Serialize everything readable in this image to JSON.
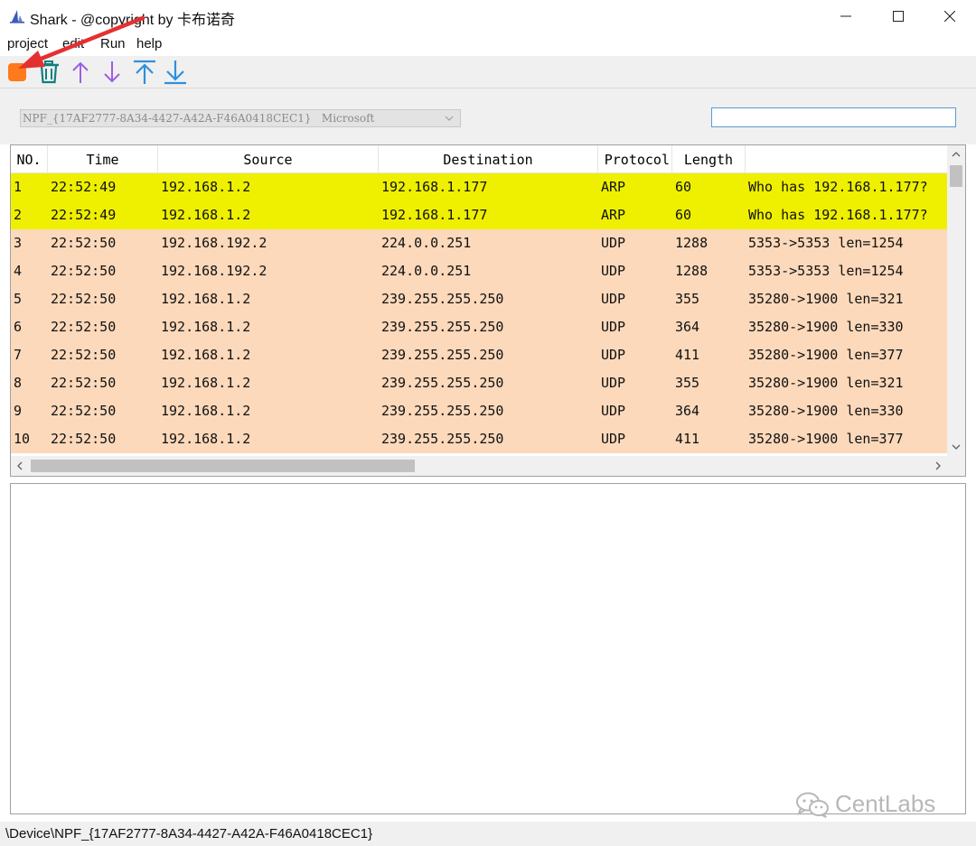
{
  "window": {
    "title": "Shark - @copyright by 卡布诺奇",
    "app_icon": "shark-fin-icon",
    "controls": [
      "minimize-icon",
      "maximize-icon",
      "close-icon"
    ]
  },
  "menu": {
    "items": [
      "project",
      "edit",
      "Run",
      "help"
    ]
  },
  "toolbar": {
    "tools": [
      {
        "name": "stop-capture",
        "icon": "stop-square-icon",
        "color": "#ff7a1a"
      },
      {
        "name": "clear",
        "icon": "trash-icon",
        "color": "#0f7f7f"
      },
      {
        "name": "scroll-up",
        "icon": "arrow-up-icon",
        "color": "#a05ce6"
      },
      {
        "name": "scroll-down",
        "icon": "arrow-down-icon",
        "color": "#a05ce6"
      },
      {
        "name": "scroll-top",
        "icon": "arrow-to-top-icon",
        "color": "#2f8fdc"
      },
      {
        "name": "scroll-bottom",
        "icon": "arrow-to-bottom-icon",
        "color": "#2f8fdc"
      }
    ]
  },
  "interface": {
    "selected": "NPF_{17AF2777-8A34-4427-A42A-F46A0418CEC1}   Microsoft"
  },
  "filter": {
    "value": "",
    "placeholder": ""
  },
  "packets": {
    "columns": [
      "NO.",
      "Time",
      "Source",
      "Destination",
      "Protocol",
      "Length",
      ""
    ],
    "rows": [
      {
        "no": "1",
        "time": "22:52:49",
        "src": "192.168.1.2",
        "dst": "192.168.1.177",
        "proto": "ARP",
        "len": "60",
        "info": "Who has 192.168.1.177?",
        "color": "#eef000"
      },
      {
        "no": "2",
        "time": "22:52:49",
        "src": "192.168.1.2",
        "dst": "192.168.1.177",
        "proto": "ARP",
        "len": "60",
        "info": "Who has 192.168.1.177?",
        "color": "#eef000"
      },
      {
        "no": "3",
        "time": "22:52:50",
        "src": "192.168.192.2",
        "dst": "224.0.0.251",
        "proto": "UDP",
        "len": "1288",
        "info": "5353->5353 len=1254",
        "color": "#fcd9bb"
      },
      {
        "no": "4",
        "time": "22:52:50",
        "src": "192.168.192.2",
        "dst": "224.0.0.251",
        "proto": "UDP",
        "len": "1288",
        "info": "5353->5353 len=1254",
        "color": "#fcd9bb"
      },
      {
        "no": "5",
        "time": "22:52:50",
        "src": "192.168.1.2",
        "dst": "239.255.255.250",
        "proto": "UDP",
        "len": "355",
        "info": "35280->1900 len=321",
        "color": "#fcd9bb"
      },
      {
        "no": "6",
        "time": "22:52:50",
        "src": "192.168.1.2",
        "dst": "239.255.255.250",
        "proto": "UDP",
        "len": "364",
        "info": "35280->1900 len=330",
        "color": "#fcd9bb"
      },
      {
        "no": "7",
        "time": "22:52:50",
        "src": "192.168.1.2",
        "dst": "239.255.255.250",
        "proto": "UDP",
        "len": "411",
        "info": "35280->1900 len=377",
        "color": "#fcd9bb"
      },
      {
        "no": "8",
        "time": "22:52:50",
        "src": "192.168.1.2",
        "dst": "239.255.255.250",
        "proto": "UDP",
        "len": "355",
        "info": "35280->1900 len=321",
        "color": "#fcd9bb"
      },
      {
        "no": "9",
        "time": "22:52:50",
        "src": "192.168.1.2",
        "dst": "239.255.255.250",
        "proto": "UDP",
        "len": "364",
        "info": "35280->1900 len=330",
        "color": "#fcd9bb"
      },
      {
        "no": "10",
        "time": "22:52:50",
        "src": "192.168.1.2",
        "dst": "239.255.255.250",
        "proto": "UDP",
        "len": "411",
        "info": "35280->1900 len=377",
        "color": "#fcd9bb"
      }
    ]
  },
  "watermark": {
    "text": "CentLabs",
    "icon": "wechat-icon"
  },
  "status": {
    "text": "\\Device\\NPF_{17AF2777-8A34-4427-A42A-F46A0418CEC1}"
  },
  "annotation": {
    "icon": "red-arrow-icon",
    "color": "#e53030"
  }
}
